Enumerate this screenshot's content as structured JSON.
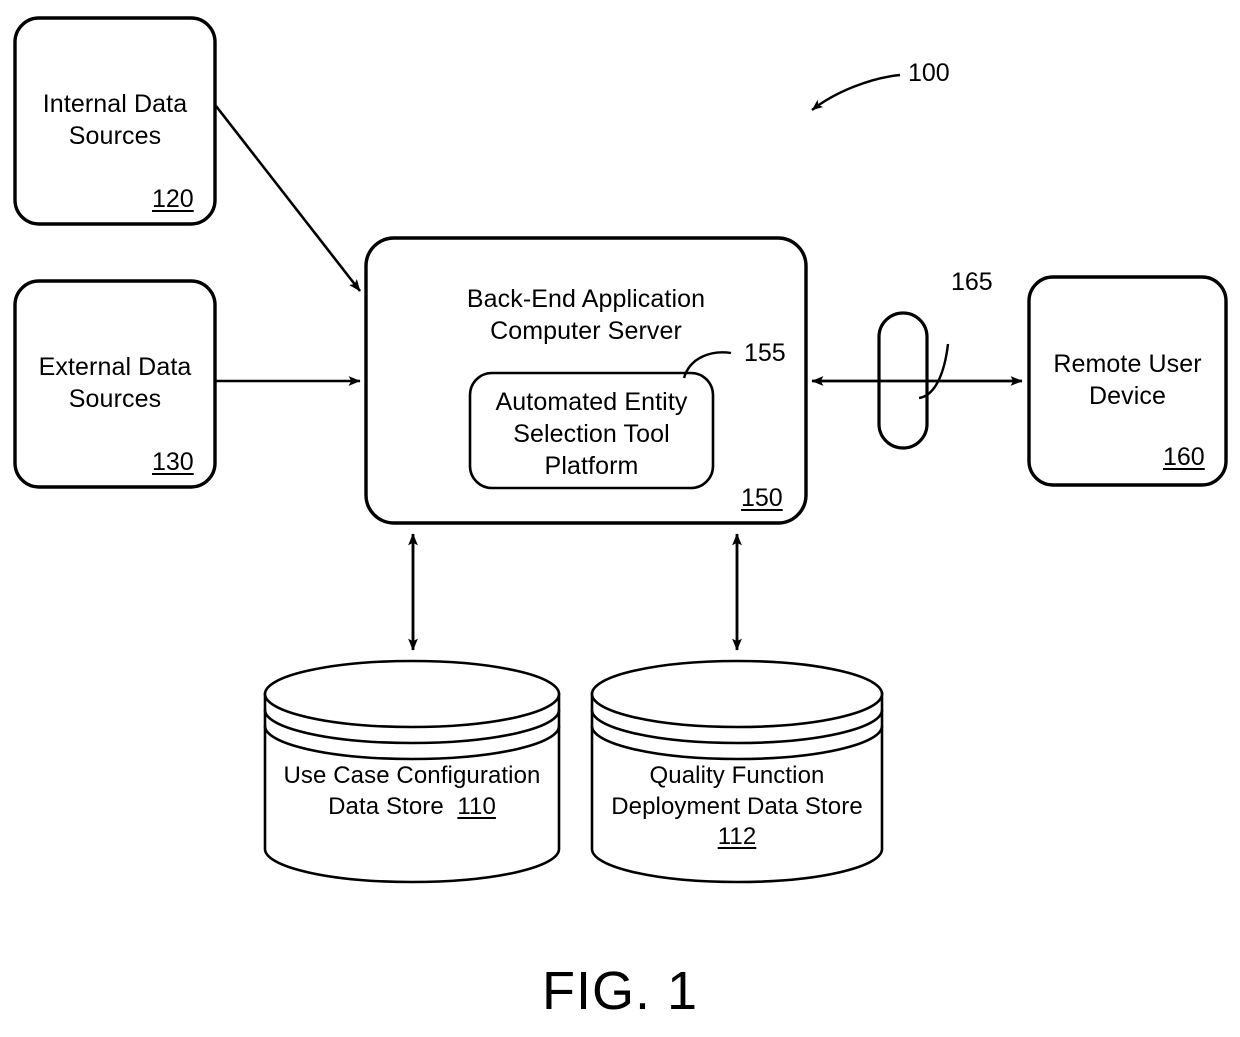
{
  "figure": {
    "caption": "FIG. 1",
    "system_ref": "100"
  },
  "nodes": {
    "internal_data_sources": {
      "label": "Internal Data\nSources",
      "ref": "120"
    },
    "external_data_sources": {
      "label": "External Data\nSources",
      "ref": "130"
    },
    "back_end_server": {
      "label": "Back-End Application\nComputer Server",
      "ref": "150"
    },
    "automated_entity_selection_tool_platform": {
      "label": "Automated Entity\nSelection Tool\nPlatform",
      "ref": "155"
    },
    "network": {
      "label": "",
      "ref": "165"
    },
    "remote_user_device": {
      "label": "Remote User\nDevice",
      "ref": "160"
    },
    "use_case_configuration_data_store": {
      "label_line1": "Use Case Configuration",
      "label_line2": "Data Store",
      "ref": "110"
    },
    "quality_function_deployment_data_store": {
      "label_line1": "Quality Function",
      "label_line2": "Deployment Data Store",
      "ref": "112"
    }
  },
  "colors": {
    "stroke": "#000000",
    "fill": "#ffffff"
  }
}
